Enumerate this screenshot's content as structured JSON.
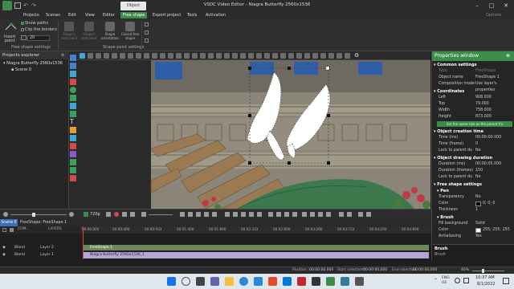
{
  "window": {
    "title": "VSDC Video Editor - Niagra Butterfly 2560x1536",
    "context_tab": "Object setti..."
  },
  "menu": {
    "items": [
      "Projects",
      "Scenes",
      "Edit",
      "View",
      "Editor",
      "Free shape",
      "Export project",
      "Tools",
      "Activation"
    ],
    "active_index": 5,
    "options_label": "Options"
  },
  "ribbon": {
    "insert_point": "Insert\npoint",
    "show_paths": "Show paths",
    "clip_borders": "Clip the borders",
    "size_value": "20",
    "group1_label": "Free shape settings",
    "buttons": [
      "Shape's start point",
      "Shape's end point",
      "Shape orientation",
      "Closed free shape"
    ],
    "group2_label": "Shape point settings"
  },
  "explorer": {
    "title": "Projects explorer",
    "project": "Niagra Butterfly 2560x1536",
    "scene": "Scene 0"
  },
  "playback": {
    "quality": "720p"
  },
  "timeline": {
    "tabs": [
      "Scene 0",
      "FreeShape: FreeShape 1"
    ],
    "header_com": "COM...",
    "header_layers": "LAYERS",
    "rows": [
      {
        "blend": "Blend",
        "layer": "Layer 2",
        "clip": "FreeShape 1"
      },
      {
        "blend": "Blend",
        "layer": "Layer 1",
        "clip": "Niagra Butterfly 2560x1536_1"
      }
    ],
    "ruler": [
      "00:00:000",
      "00:00:466",
      "00:00:933",
      "00:01:400",
      "00:01:866",
      "00:02:333",
      "00:02:800",
      "00:03:266",
      "00:03:733",
      "00:04:200",
      "00:04:666"
    ]
  },
  "properties": {
    "title": "Properties window",
    "common_section": "Common settings",
    "type_label": "Type",
    "type_value": "FreeShape",
    "object_name_label": "Object name",
    "object_name_value": "FreeShape 1",
    "composition_label": "Composition mode",
    "composition_value": "Use layer's properties",
    "coords_section": "Coordinates",
    "left_label": "Left",
    "left_value": "908.000",
    "top_label": "Top",
    "top_value": "79.000",
    "width_label": "Width",
    "width_value": "758.000",
    "height_label": "Height",
    "height_value": "873.000",
    "same_size": "Set the same size as the parent fra",
    "creation_section": "Object creation time",
    "time_ms_label": "Time (ms)",
    "time_ms_value": "00:00:00.000",
    "time_frame_label": "Time (frame)",
    "time_frame_value": "0",
    "lock_parent_label": "Lock to parent du",
    "lock_parent_value": "No",
    "duration_section": "Object drawing duration",
    "duration_ms_label": "Duration (ms)",
    "duration_ms_value": "00:00:05.000",
    "duration_frames_label": "Duration (frames)",
    "duration_frames_value": "150",
    "lock_parent2_label": "Lock to parent du",
    "lock_parent2_value": "No",
    "freeshape_section": "Free shape settings",
    "pen_section": "Pen",
    "transparency_label": "Transparency",
    "transparency_value": "No",
    "color_label": "Color",
    "color_value": "0; 0; 0",
    "thickness_label": "Thickness",
    "thickness_value": "1",
    "brush_section": "Brush",
    "fill_bg_label": "Fill background",
    "fill_bg_value": "Solid",
    "brush_color_label": "Color",
    "brush_color_value": "255; 255; 255",
    "antialiasing_label": "Antialiasing",
    "antialiasing_value": "Yes",
    "footer_title": "Brush",
    "footer_desc": "Brush"
  },
  "status": {
    "position_label": "Position:",
    "position_value": "00:00:00.000",
    "start_sel_label": "Start selection:",
    "start_sel_value": "00:00:00.000",
    "end_sel_label": "End selection:",
    "end_sel_value": "00:00:00.000",
    "zoom": "40%"
  },
  "taskbar": {
    "time": "10:37 AM",
    "date": "8/1/2022",
    "lang": "ENG\nUS"
  },
  "colors": {
    "accent": "#3c8d4a",
    "timeline_clip": "#b5a5d6",
    "freeshape_clip": "#6d8a5e"
  }
}
